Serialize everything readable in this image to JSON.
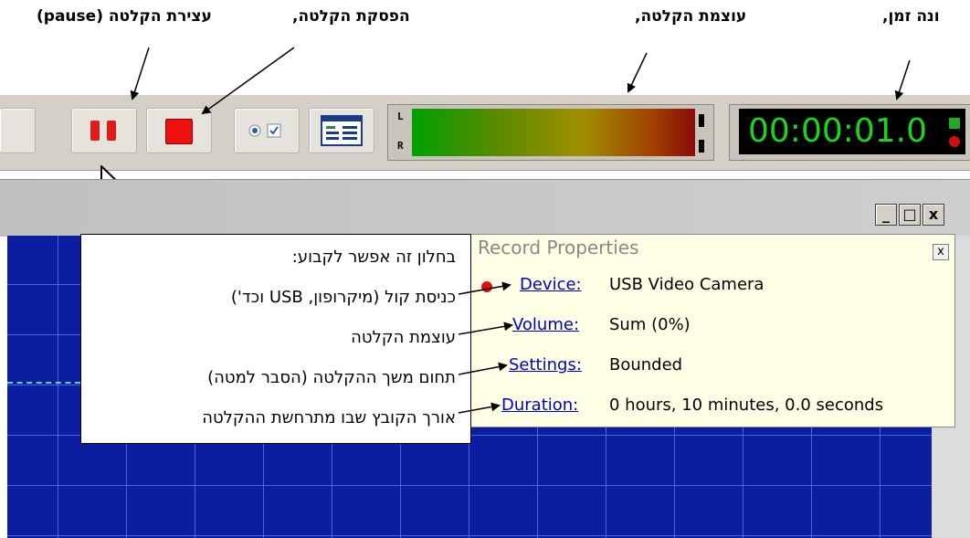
{
  "captions": {
    "pause": "עצירת הקלטה (pause)",
    "stop": "הפסקת הקלטה,",
    "volume": "עוצמת הקלטה,",
    "timer": "ונה זמן,"
  },
  "toolbar": {
    "meter_left_label": "L",
    "meter_right_label": "R",
    "clock_value": "00:00:01.0"
  },
  "window_controls": {
    "minimize": "_",
    "maximize": "□",
    "close": "x"
  },
  "record_properties": {
    "title": "Record Properties",
    "close_label": "x",
    "rows": [
      {
        "label": "Device:",
        "value": "USB Video Camera"
      },
      {
        "label": "Volume:",
        "value": "Sum (0%)"
      },
      {
        "label": "Settings:",
        "value": "Bounded"
      },
      {
        "label": "Duration:",
        "value": "0 hours, 10 minutes, 0.0 seconds"
      }
    ]
  },
  "annotation_box": {
    "lines": [
      "בחלון זה אפשר לקבוע:",
      "כניסת קול (מיקרופון, USB וכד')",
      "עוצמת הקלטה",
      "תחום משך ההקלטה (הסבר למטה)",
      "אורך הקובץ שבו מתרחשת ההקלטה"
    ]
  },
  "colors": {
    "toolbar_bg": "#d4d0c8",
    "pause_red": "#e11919",
    "stop_red": "#ee1010",
    "clock_green": "#1fd21f",
    "grid_blue": "#0c1ea0",
    "link_blue": "#0000cc",
    "props_bg": "#ffffe6"
  },
  "icons": [
    "pause-icon",
    "stop-icon",
    "options-icon",
    "window-layout-icon",
    "record-dot-icon",
    "mouse-cursor-icon"
  ]
}
